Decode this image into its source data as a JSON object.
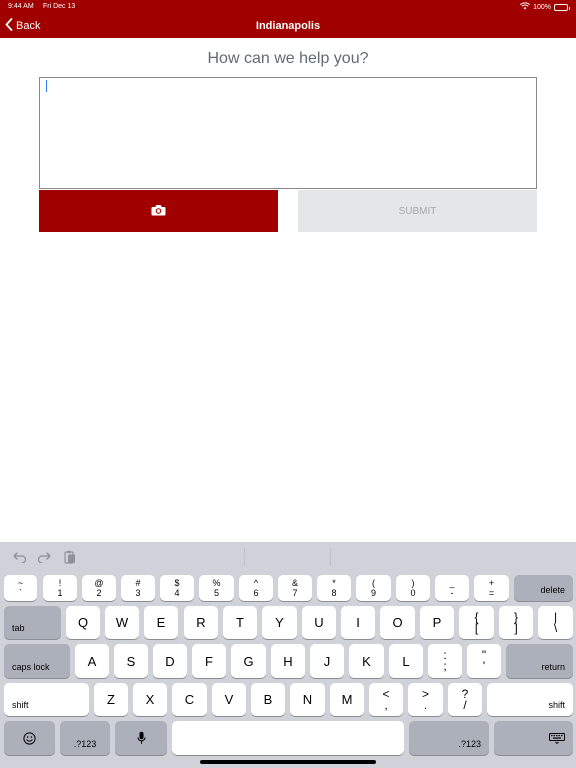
{
  "status_bar": {
    "time": "9:44 AM",
    "date": "Fri Dec 13",
    "battery": "100%",
    "wifi_icon": "wifi-icon",
    "battery_icon": "battery-icon"
  },
  "nav": {
    "back_label": "Back",
    "title": "Indianapolis",
    "back_icon": "chevron-left-icon"
  },
  "form": {
    "prompt": "How can we help you?",
    "message_value": "",
    "camera_icon": "camera-icon",
    "submit_label": "SUBMIT"
  },
  "colors": {
    "brand": "#a00000",
    "submit_disabled_bg": "#e4e6e8",
    "submit_disabled_text": "#a5a9ad",
    "keyboard_bg": "#cfd2d8"
  },
  "keyboard": {
    "shortcut_icons": [
      "undo-icon",
      "redo-icon",
      "paste-icon"
    ],
    "number_row": [
      {
        "top": "~",
        "bottom": "`"
      },
      {
        "top": "!",
        "bottom": "1"
      },
      {
        "top": "@",
        "bottom": "2"
      },
      {
        "top": "#",
        "bottom": "3"
      },
      {
        "top": "$",
        "bottom": "4"
      },
      {
        "top": "%",
        "bottom": "5"
      },
      {
        "top": "^",
        "bottom": "6"
      },
      {
        "top": "&",
        "bottom": "7"
      },
      {
        "top": "*",
        "bottom": "8"
      },
      {
        "top": "(",
        "bottom": "9"
      },
      {
        "top": ")",
        "bottom": "0"
      },
      {
        "top": "_",
        "bottom": "-"
      },
      {
        "top": "+",
        "bottom": "="
      }
    ],
    "delete": "delete",
    "tab": "tab",
    "row_q": [
      "Q",
      "W",
      "E",
      "R",
      "T",
      "Y",
      "U",
      "I",
      "O",
      "P"
    ],
    "row_q_extra": [
      {
        "top": "{",
        "bottom": "["
      },
      {
        "top": "}",
        "bottom": "]"
      },
      {
        "top": "|",
        "bottom": "\\"
      }
    ],
    "caps_lock": "caps lock",
    "row_a": [
      "A",
      "S",
      "D",
      "F",
      "G",
      "H",
      "J",
      "K",
      "L"
    ],
    "row_a_extra": [
      {
        "top": ":",
        "bottom": ";"
      },
      {
        "top": "\"",
        "bottom": "'"
      }
    ],
    "return": "return",
    "shift": "shift",
    "row_z": [
      "Z",
      "X",
      "C",
      "V",
      "B",
      "N",
      "M"
    ],
    "row_z_extra": [
      {
        "top": "<",
        "bottom": ","
      },
      {
        "top": ">",
        "bottom": "."
      },
      {
        "top": "?",
        "bottom": "/"
      }
    ],
    "numbers_toggle": ".?123",
    "emoji_icon": "emoji-icon",
    "mic_icon": "microphone-icon",
    "dismiss_icon": "keyboard-dismiss-icon"
  }
}
